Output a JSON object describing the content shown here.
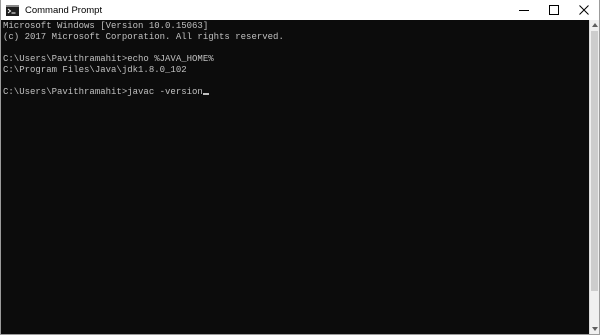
{
  "window": {
    "title": "Command Prompt",
    "icon": "cmd-icon",
    "controls": [
      "minimize-icon",
      "maximize-icon",
      "close-icon"
    ]
  },
  "console": {
    "lines": [
      "Microsoft Windows [Version 10.0.15063]",
      "(c) 2017 Microsoft Corporation. All rights reserved.",
      "",
      "C:\\Users\\Pavithramahit>echo %JAVA_HOME%",
      "C:\\Program Files\\Java\\jdk1.8.0_102",
      "",
      "C:\\Users\\Pavithramahit>javac -version"
    ]
  },
  "colors": {
    "console_bg": "#0c0c0c",
    "console_text": "#c0c0c0",
    "titlebar_bg": "#ffffff"
  }
}
